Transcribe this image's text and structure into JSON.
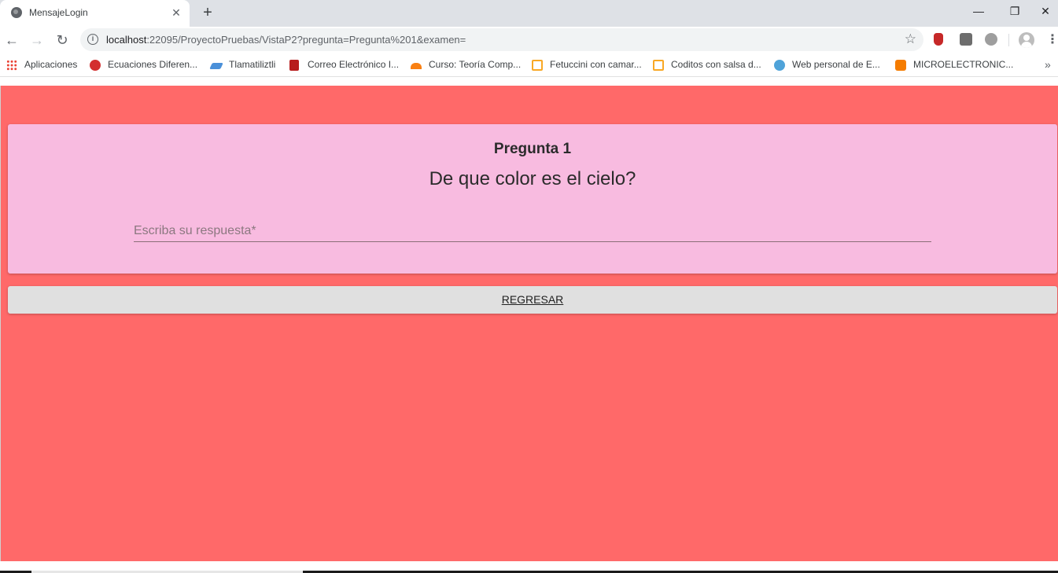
{
  "browser": {
    "tab_title": "MensajeLogin",
    "tab_close": "✕",
    "new_tab": "+",
    "window": {
      "minimize": "—",
      "maximize": "❐",
      "close": "✕"
    },
    "nav": {
      "back": "←",
      "forward": "→",
      "reload": "↻"
    },
    "url_host": "localhost",
    "url_rest": ":22095/ProyectoPruebas/VistaP2?pregunta=Pregunta%201&examen=",
    "info_icon": "i",
    "star_icon": "☆",
    "menu": "⋮",
    "bookmarks": [
      {
        "label": "Aplicaciones",
        "icon": "apps-icon",
        "color": "#ea4335"
      },
      {
        "label": "Ecuaciones Diferen...",
        "icon": "apple-icon",
        "color": "#d32f2f"
      },
      {
        "label": "Tlamatiliztli",
        "icon": "pen-icon",
        "color": "#4a90d9"
      },
      {
        "label": "Correo Electrónico I...",
        "icon": "university-icon",
        "color": "#b71c1c"
      },
      {
        "label": "Curso: Teoría Comp...",
        "icon": "moodle-icon",
        "color": "#f98012"
      },
      {
        "label": "Fetuccini con camar...",
        "icon": "recipe-box-icon",
        "color": "#f9a825"
      },
      {
        "label": "Coditos con salsa d...",
        "icon": "recipe-box-icon",
        "color": "#f9a825"
      },
      {
        "label": "Web personal de E...",
        "icon": "network-icon",
        "color": "#4fa3d9"
      },
      {
        "label": "MICROELECTRONIC...",
        "icon": "blogger-icon",
        "color": "#f57c00"
      }
    ],
    "bookmarks_more": "»"
  },
  "page": {
    "background_color": "#ff6969",
    "card_color": "#f8bbe0",
    "question_number": "Pregunta 1",
    "question_text": "De que color es el cielo?",
    "answer_placeholder": "Escriba su respuesta*",
    "answer_value": "",
    "back_button": "REGRESAR"
  }
}
